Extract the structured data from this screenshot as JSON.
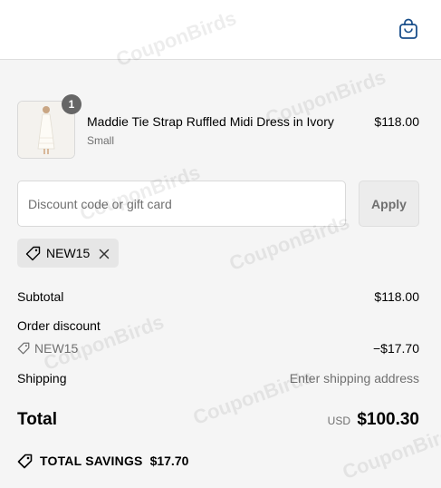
{
  "header": {
    "bag_icon": "shopping-bag-icon"
  },
  "cart": {
    "items": [
      {
        "quantity": "1",
        "name": "Maddie Tie Strap Ruffled Midi Dress in Ivory",
        "variant": "Small",
        "price": "$118.00"
      }
    ]
  },
  "discount": {
    "placeholder": "Discount code or gift card",
    "value": "",
    "apply_label": "Apply",
    "applied_code": "NEW15"
  },
  "totals": {
    "subtotal_label": "Subtotal",
    "subtotal_value": "$118.00",
    "order_discount_label": "Order discount",
    "discount_code": "NEW15",
    "discount_amount": "−$17.70",
    "shipping_label": "Shipping",
    "shipping_value": "Enter shipping address",
    "total_label": "Total",
    "currency": "USD",
    "total_value": "$100.30",
    "savings_label": "TOTAL SAVINGS",
    "savings_value": "$17.70"
  },
  "watermark": "CouponBirds",
  "colors": {
    "background": "#f5f5f5",
    "muted_text": "#707070",
    "badge": "#666666",
    "accent_icon": "#1a4f8b"
  }
}
